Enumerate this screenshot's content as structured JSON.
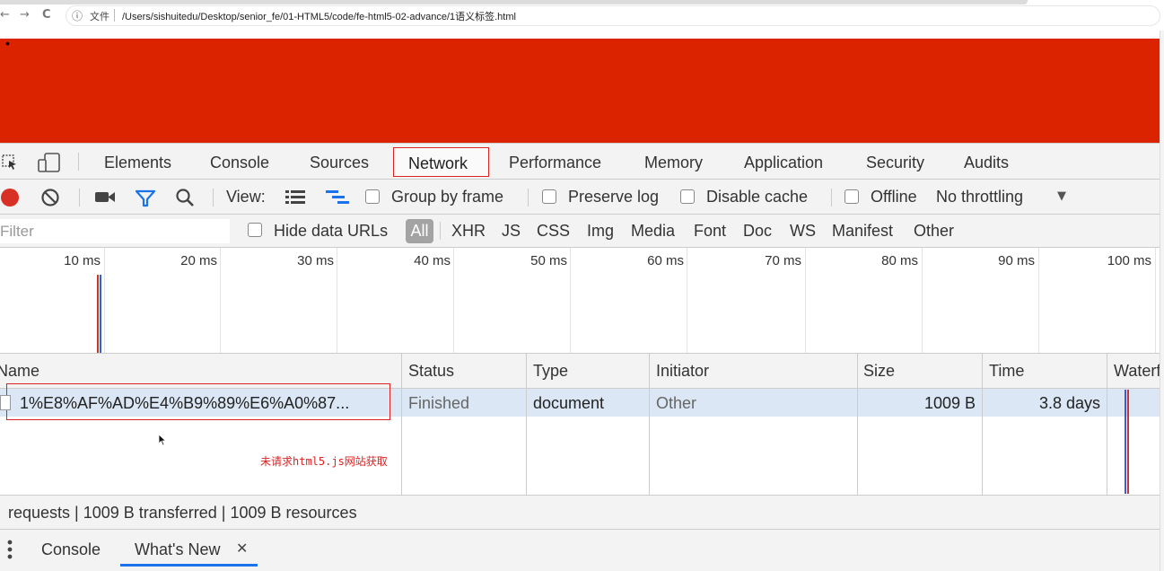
{
  "browser": {
    "back": "←",
    "forward": "→",
    "reload": "C",
    "info": "ⓘ",
    "file_label": "文件",
    "url": "/Users/sishuitedu/Desktop/senior_fe/01-HTML5/code/fe-html5-02-advance/1语义标签.html"
  },
  "page": {
    "background_color": "#dc2300",
    "bullet": "•"
  },
  "devtools": {
    "tabs": [
      "Elements",
      "Console",
      "Sources",
      "Network",
      "Performance",
      "Memory",
      "Application",
      "Security",
      "Audits"
    ],
    "active_tab": "Network",
    "toolbar": {
      "view_label": "View:",
      "group_by_frame": "Group by frame",
      "preserve_log": "Preserve log",
      "disable_cache": "Disable cache",
      "offline": "Offline",
      "throttling": "No throttling",
      "caret": "▼"
    },
    "filter": {
      "placeholder": "Filter",
      "hide_data_urls": "Hide data URLs",
      "types": [
        "All",
        "XHR",
        "JS",
        "CSS",
        "Img",
        "Media",
        "Font",
        "Doc",
        "WS",
        "Manifest",
        "Other"
      ]
    },
    "overview_ticks": [
      "10 ms",
      "20 ms",
      "30 ms",
      "40 ms",
      "50 ms",
      "60 ms",
      "70 ms",
      "80 ms",
      "90 ms",
      "100 ms"
    ],
    "table": {
      "headers": [
        "Name",
        "Status",
        "Type",
        "Initiator",
        "Size",
        "Time",
        "Waterfall"
      ],
      "rows": [
        {
          "name": "1%E8%AF%AD%E4%B9%89%E6%A0%87...",
          "status": "Finished",
          "type": "document",
          "initiator": "Other",
          "size": "1009 B",
          "time": "3.8 days"
        }
      ]
    },
    "annotation": "未请求html5.js网站获取",
    "summary": "requests | 1009 B transferred | 1009 B resources",
    "drawer": {
      "tabs": [
        "Console",
        "What's New"
      ],
      "active_tab": "What's New",
      "close": "✕"
    }
  }
}
